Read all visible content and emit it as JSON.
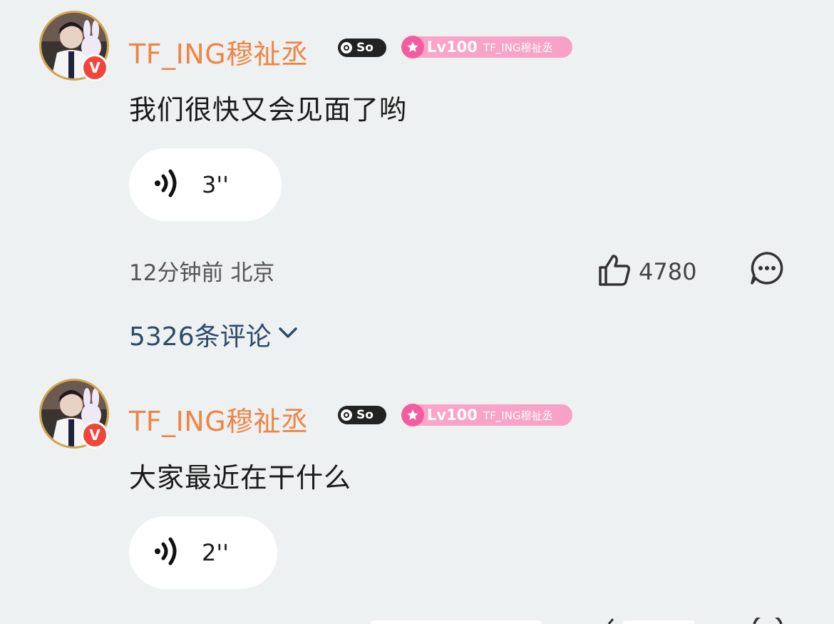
{
  "posts": [
    {
      "username": "TF_ING穆祉丞",
      "verified_badge": "V",
      "so_badge": "So",
      "level": "Lv100",
      "level_name": "TF_ING穆祉丞",
      "text": "我们很快又会见面了哟",
      "voice_duration": "3''",
      "timestamp": "12分钟前",
      "location": "北京",
      "likes": "4780",
      "comments_link": "5326条评论"
    },
    {
      "username": "TF_ING穆祉丞",
      "verified_badge": "V",
      "so_badge": "So",
      "level": "Lv100",
      "level_name": "TF_ING穆祉丞",
      "text": "大家最近在干什么",
      "voice_duration": "2''"
    }
  ],
  "colors": {
    "background": "#eef1f1",
    "username": "#ee8445",
    "level_badge": "#f7a1c6",
    "verified": "#f1453a",
    "comments_link": "#2e4a6b"
  },
  "icons": [
    "speaker-icon",
    "thumbs-up-icon",
    "comment-bubble-icon",
    "chevron-down-icon",
    "star-icon"
  ]
}
